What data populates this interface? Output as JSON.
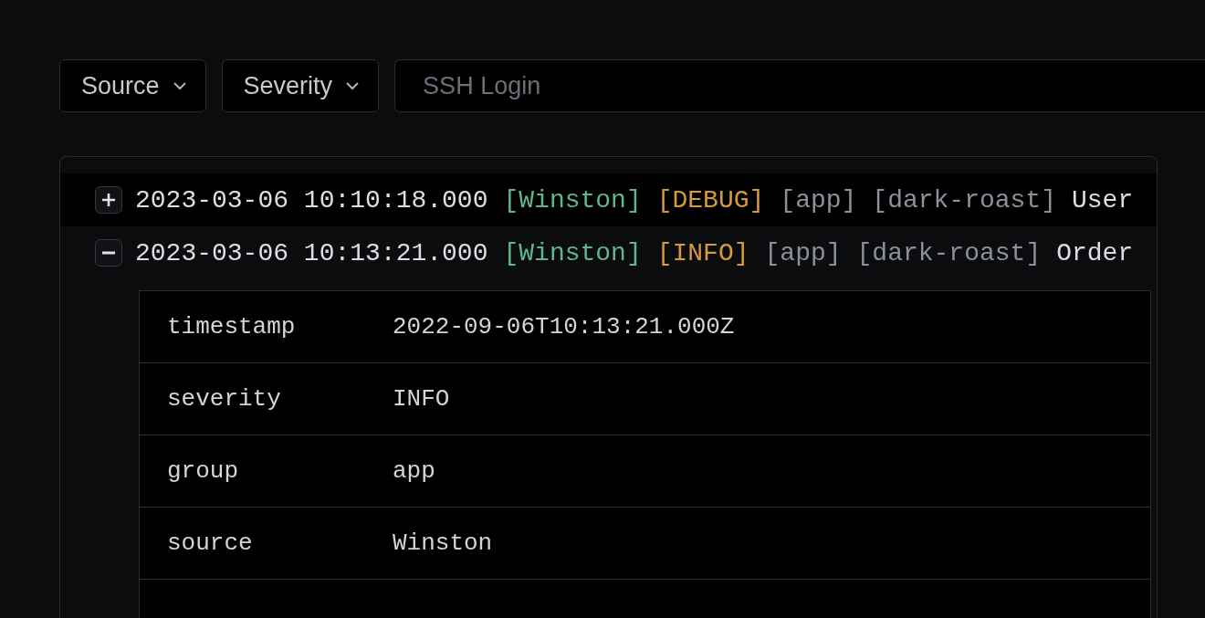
{
  "filters": [
    {
      "label": "Source"
    },
    {
      "label": "Severity"
    }
  ],
  "search": {
    "placeholder": "SSH Login"
  },
  "logs": [
    {
      "timestamp": "2023-03-06 10:10:18.000",
      "source": "[Winston]",
      "severity": "[DEBUG]",
      "group": "[app]",
      "roast": "[dark-roast]",
      "message": "User",
      "expanded": false,
      "highlighted": true
    },
    {
      "timestamp": "2023-03-06 10:13:21.000",
      "source": "[Winston]",
      "severity": "[INFO]",
      "group": "[app]",
      "roast": "[dark-roast]",
      "message": "Order",
      "expanded": true,
      "highlighted": false,
      "fields": [
        {
          "key": "timestamp",
          "value": "2022-09-06T10:13:21.000Z"
        },
        {
          "key": "severity",
          "value": "INFO"
        },
        {
          "key": "group",
          "value": "app"
        },
        {
          "key": "source",
          "value": "Winston"
        }
      ]
    }
  ]
}
